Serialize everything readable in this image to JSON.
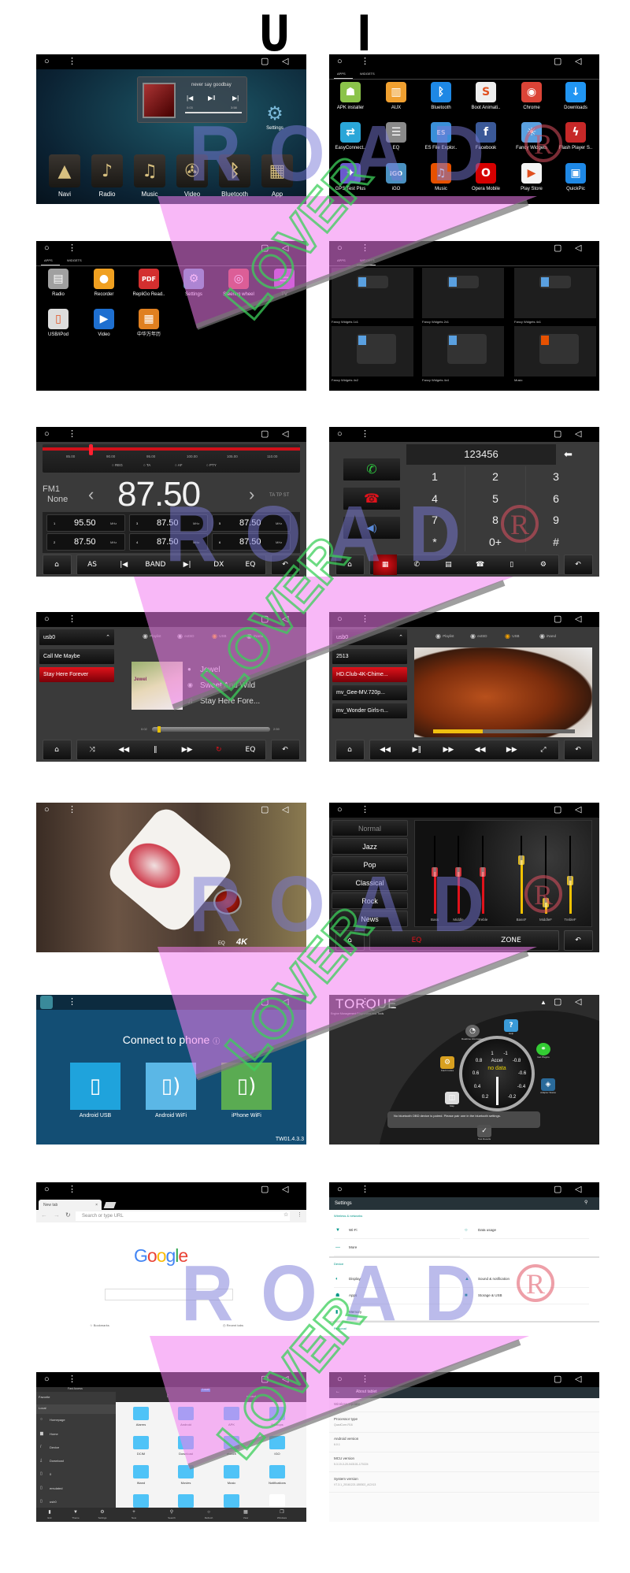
{
  "title": "U I",
  "watermark": {
    "brand": "ROAD",
    "sub": "LOVER",
    "registered": "®"
  },
  "colors": {
    "accent_red": "#e0121b",
    "settings_teal": "#009688",
    "eq_yellow": "#f2c200",
    "connect_blue": "#134e74"
  },
  "home": {
    "widget": {
      "song": "never say goodbay",
      "elapsed": "0:03",
      "total": "3:58",
      "progress": 0.05
    },
    "settings_label": "Settings",
    "dock": [
      {
        "label": "Navi",
        "icon": "navigation-arrow-icon"
      },
      {
        "label": "Radio",
        "icon": "gramophone-icon"
      },
      {
        "label": "Music",
        "icon": "music-note-icon"
      },
      {
        "label": "Video",
        "icon": "film-reel-icon"
      },
      {
        "label": "Bluetooth",
        "icon": "bluetooth-icon"
      },
      {
        "label": "App",
        "icon": "app-grid-icon"
      }
    ]
  },
  "apps1": {
    "tabs": [
      "APPS",
      "WIDGETS"
    ],
    "active_tab": "APPS",
    "apps": [
      {
        "label": "APK installer",
        "icon": "android-icon",
        "color": "#8bc34a"
      },
      {
        "label": "AUX",
        "icon": "aux-icon",
        "color": "#f0a030"
      },
      {
        "label": "Bluetooth",
        "icon": "bluetooth-icon",
        "color": "#1e88e5"
      },
      {
        "label": "Boot Animati..",
        "icon": "boot-animation-icon",
        "color": "#eeeeee"
      },
      {
        "label": "Chrome",
        "icon": "chrome-icon",
        "color": "#db4437"
      },
      {
        "label": "Downloads",
        "icon": "download-icon",
        "color": "#2196f3"
      },
      {
        "label": "EasyConnect..",
        "icon": "easyconnect-icon",
        "color": "#2aa6d8"
      },
      {
        "label": "EQ",
        "icon": "equalizer-icon",
        "color": "#8a8a8a"
      },
      {
        "label": "ES File Explor..",
        "icon": "es-file-icon",
        "color": "#3a8fd8"
      },
      {
        "label": "Facebook",
        "icon": "facebook-icon",
        "color": "#3b5998"
      },
      {
        "label": "Fancy Widgets",
        "icon": "weather-icon",
        "color": "#5aa0e0"
      },
      {
        "label": "Flash Player S..",
        "icon": "flash-icon",
        "color": "#c62828"
      },
      {
        "label": "GPS Test Plus",
        "icon": "gps-icon",
        "color": "#6a5acd"
      },
      {
        "label": "iGO",
        "icon": "igo-icon",
        "color": "#4a90c0"
      },
      {
        "label": "Music",
        "icon": "music-note-icon",
        "color": "#e65100"
      },
      {
        "label": "Opera Mobile",
        "icon": "opera-icon",
        "color": "#d50000"
      },
      {
        "label": "Play Store",
        "icon": "play-store-icon",
        "color": "#f5f5f5"
      },
      {
        "label": "QuickPic",
        "icon": "quickpic-icon",
        "color": "#1e88e5"
      }
    ]
  },
  "apps2": {
    "tabs": [
      "APPS",
      "WIDGETS"
    ],
    "active_tab": "APPS",
    "apps": [
      {
        "label": "Radio",
        "icon": "radio-icon",
        "color": "#a0a0a0"
      },
      {
        "label": "Recorder",
        "icon": "recorder-icon",
        "color": "#f0a020"
      },
      {
        "label": "RepliGo Read..",
        "icon": "pdf-icon",
        "color": "#d32f2f"
      },
      {
        "label": "Settings",
        "icon": "gear-icon",
        "color": "#5a8fb0"
      },
      {
        "label": "Steering wheel",
        "icon": "steering-wheel-icon",
        "color": "#c0392b"
      },
      {
        "label": "TV",
        "icon": "tv-icon",
        "color": "#b040c0"
      },
      {
        "label": "USB/iPod",
        "icon": "usb-ipod-icon",
        "color": "#dddddd"
      },
      {
        "label": "Video",
        "icon": "video-clapper-icon",
        "color": "#1e6fd0"
      },
      {
        "label": "中华万年历",
        "icon": "calendar-icon",
        "color": "#e08020"
      }
    ]
  },
  "widgets": {
    "tabs": [
      "APPS",
      "WIDGETS"
    ],
    "active_tab": "WIDGETS",
    "items": [
      {
        "label": "Fancy Widgets 1x1"
      },
      {
        "label": "Fancy Widgets 2x1"
      },
      {
        "label": "Fancy Widgets 4x1"
      },
      {
        "label": "Fancy Widgets 4x2"
      },
      {
        "label": "Fancy Widgets 4x4"
      },
      {
        "label": "Music"
      }
    ]
  },
  "radio": {
    "scale": [
      "85.00",
      "90.00",
      "95.00",
      "100.00",
      "105.00",
      "110.00"
    ],
    "scale_range": [
      85,
      110
    ],
    "tuned_mhz": 87.5,
    "flags": [
      "REG",
      "TA",
      "AF",
      "PTY"
    ],
    "band": "FM1",
    "ps_name": "None",
    "frequency": "87.50",
    "indicators": "TA  TP  ST",
    "presets": [
      {
        "n": "1",
        "f": "95.50",
        "u": "MHz"
      },
      {
        "n": "3",
        "f": "87.50",
        "u": "MHz"
      },
      {
        "n": "5",
        "f": "87.50",
        "u": "MHz"
      },
      {
        "n": "2",
        "f": "87.50",
        "u": "MHz"
      },
      {
        "n": "4",
        "f": "87.50",
        "u": "MHz"
      },
      {
        "n": "6",
        "f": "87.50",
        "u": "MHz"
      }
    ],
    "bottom_bar": [
      {
        "icon": "home-icon"
      },
      {
        "label": "AS"
      },
      {
        "icon": "skip-previous-icon"
      },
      {
        "label": "BAND"
      },
      {
        "icon": "skip-next-icon"
      },
      {
        "label": "DX"
      },
      {
        "label": "EQ"
      },
      {
        "icon": "back-icon"
      }
    ]
  },
  "phone": {
    "number": "123456",
    "keys": [
      "1",
      "2",
      "3",
      "4",
      "5",
      "6",
      "7",
      "8",
      "9",
      "*",
      "0+",
      "#"
    ],
    "bottom_bar": [
      {
        "icon": "home-icon"
      },
      {
        "icon": "dialpad-icon",
        "active": true
      },
      {
        "icon": "call-log-icon"
      },
      {
        "icon": "contacts-icon"
      },
      {
        "icon": "phone-icon"
      },
      {
        "icon": "phone-device-icon"
      },
      {
        "icon": "gear-icon"
      },
      {
        "icon": "back-icon"
      }
    ]
  },
  "music": {
    "source_label": "usb0",
    "sources": [
      "Playlist",
      "extSD",
      "USB",
      "iNand"
    ],
    "active_source": "USB",
    "tracks": [
      "Call Me Maybe",
      "Stay Here Forever"
    ],
    "active_track": "Stay Here Forever",
    "artist": "Jewel",
    "album": "Sweet And Wild",
    "title": "Stay Here Fore...",
    "album_art_text": "Jewel",
    "elapsed": "0:02",
    "total": "2:59",
    "progress": 0.05,
    "bottom_bar": [
      {
        "icon": "home-icon"
      },
      {
        "icon": "shuffle-icon"
      },
      {
        "icon": "previous-icon"
      },
      {
        "icon": "pause-icon"
      },
      {
        "icon": "next-icon"
      },
      {
        "icon": "repeat-icon",
        "active": true
      },
      {
        "label": "EQ"
      },
      {
        "icon": "back-icon"
      }
    ]
  },
  "video": {
    "source_label": "usb0",
    "sources": [
      "Playlist",
      "extSD",
      "USB",
      "iNand"
    ],
    "active_source": "USB",
    "files": [
      "2513",
      "HD.Club-4K-Chime...",
      "mv_Gee-MV.720p...",
      "mv_Wonder Girls-n..."
    ],
    "active_file": "HD.Club-4K-Chime...",
    "progress": 0.35,
    "bottom_bar": [
      {
        "icon": "home-icon"
      },
      {
        "icon": "previous-icon"
      },
      {
        "icon": "play-pause-icon"
      },
      {
        "icon": "next-icon"
      },
      {
        "icon": "rewind-icon"
      },
      {
        "icon": "fast-forward-icon"
      },
      {
        "icon": "fullscreen-icon"
      },
      {
        "icon": "back-icon"
      }
    ]
  },
  "fullscreen_video": {
    "badge": "4K",
    "eq_badge": "EQ"
  },
  "eq": {
    "presets": [
      "Normal",
      "Jazz",
      "Pop",
      "Classical",
      "Rock",
      "News"
    ],
    "active_preset": "Normal",
    "sliders": [
      {
        "label": "Bass",
        "level": 0.54,
        "color": "#e0121b"
      },
      {
        "label": "Middle",
        "level": 0.54,
        "color": "#e0121b"
      },
      {
        "label": "Treble",
        "level": 0.54,
        "color": "#e0121b"
      },
      {
        "label": "BassF",
        "level": 0.69,
        "color": "#f2c200"
      },
      {
        "label": "MiddleF",
        "level": 0.14,
        "color": "#f2c200"
      },
      {
        "label": "TrebleF",
        "level": 0.42,
        "color": "#f2c200"
      }
    ],
    "tab_eq": "EQ",
    "tab_zone": "ZONE",
    "active_tab": "EQ"
  },
  "connect": {
    "title": "Connect to phone",
    "options": [
      {
        "label": "Android USB",
        "color": "#1fa3dc"
      },
      {
        "label": "Android WiFi",
        "color": "#5bb7e6"
      },
      {
        "label": "iPhone WiFi",
        "color": "#5aab52"
      }
    ],
    "version": "TW01.4.3.3"
  },
  "torque": {
    "title": "TORQUE",
    "subtitle": "Engine Management Diagnostics and Tools",
    "gauge": {
      "name": "Accel",
      "value": "no data",
      "ticks": [
        "1",
        "-1",
        "0.8",
        "-0.8",
        "0.6",
        "-0.6",
        "0.4",
        "-0.4",
        "0.2",
        "-0.2"
      ]
    },
    "icons": [
      {
        "label": "Realtime Information",
        "icon": "dashboard-icon"
      },
      {
        "label": "Help",
        "icon": "help-icon"
      },
      {
        "label": "Get Plugins",
        "icon": "plugins-icon"
      },
      {
        "label": "Fault Codes",
        "icon": "engine-icon"
      },
      {
        "label": "Adapter Status",
        "icon": "adapter-icon"
      },
      {
        "label": "Map",
        "icon": "map-icon"
      },
      {
        "label": "Test Results",
        "icon": "test-icon"
      }
    ],
    "toast": "No bluetooth OBD device is paired. Please pair one in the bluetooth settings."
  },
  "browser": {
    "tab": "New tab",
    "url_placeholder": "Search or type URL",
    "logo": "Google",
    "bookmarks": "Bookmarks",
    "recent_tabs": "Recent tabs"
  },
  "settings": {
    "title": "Settings",
    "sections": [
      {
        "header": "Wireless & networks",
        "items": [
          {
            "label": "Wi-Fi",
            "icon": "wifi-icon"
          },
          {
            "label": "Data usage",
            "icon": "data-usage-icon"
          },
          {
            "label": "More",
            "icon": "more-icon"
          }
        ]
      },
      {
        "header": "Device",
        "items": [
          {
            "label": "Display",
            "icon": "display-icon"
          },
          {
            "label": "Sound & notification",
            "icon": "bell-icon"
          },
          {
            "label": "Apps",
            "icon": "android-icon"
          },
          {
            "label": "Storage & USB",
            "icon": "storage-icon"
          },
          {
            "label": "Memory",
            "icon": "memory-icon"
          }
        ]
      },
      {
        "header": "Personal",
        "items": []
      }
    ]
  },
  "files": {
    "fast_access": "Fast Access",
    "favorite": "Favorite",
    "local": "Local",
    "nav": [
      "Homepage",
      "Home",
      "Device",
      "Download",
      "0",
      "emulated",
      "usb0"
    ],
    "path_root": "/",
    "path_current": "sdcard",
    "location_badge": "Local",
    "folders": [
      "Alarms",
      "Android",
      "APK",
      "Backups",
      "DCIM",
      "Download",
      "etouch",
      "IGO",
      "iNand",
      "Movies",
      "Music",
      "Notifications"
    ],
    "bottom": [
      "Exit",
      "Theme",
      "Settings",
      "New",
      "Search",
      "Refresh",
      "View",
      "Windows"
    ]
  },
  "about": {
    "title": "About tablet",
    "items": [
      {
        "label": "Wireless Update",
        "value": ""
      },
      {
        "label": "Processor type",
        "value": "QuadCore-R16"
      },
      {
        "label": "Android version",
        "value": "6.0.1"
      },
      {
        "label": "MCU version",
        "value": "5.3.19-3-20-043101-170224"
      },
      {
        "label": "System version",
        "value": "V7.3.1_20161221.185302_ACX13"
      }
    ]
  }
}
